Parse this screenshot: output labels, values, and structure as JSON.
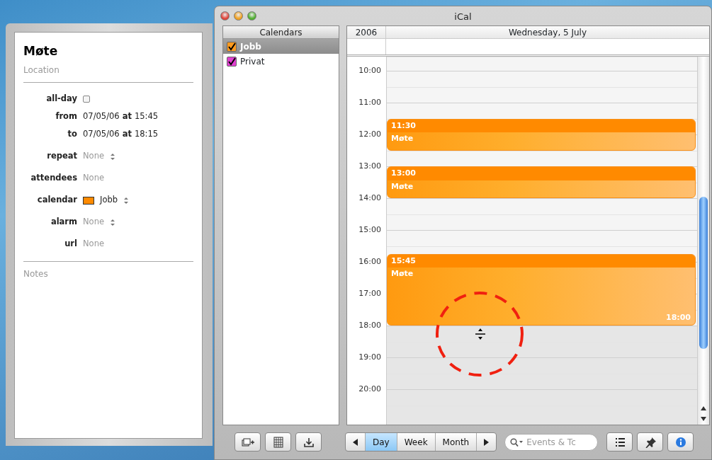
{
  "info_panel": {
    "title": "Møte",
    "location_placeholder": "Location",
    "fields": [
      {
        "kind": "checkbox",
        "label": "all-day",
        "checked": false
      },
      {
        "kind": "date",
        "label": "from",
        "value": "07/05/06 **at** 15:45"
      },
      {
        "kind": "date",
        "label": "to",
        "value": "07/05/06 **at** 18:15"
      },
      {
        "kind": "select",
        "label": "repeat",
        "placeholder": "None"
      },
      {
        "kind": "text",
        "label": "attendees",
        "placeholder": "None"
      },
      {
        "kind": "color-select",
        "label": "calendar",
        "value": "Jobb",
        "color": "#ff8a00"
      },
      {
        "kind": "select",
        "label": "alarm",
        "placeholder": "None"
      },
      {
        "kind": "text",
        "label": "url",
        "placeholder": "None"
      }
    ],
    "notes_placeholder": "Notes"
  },
  "window": {
    "title": "iCal"
  },
  "calendars": {
    "header": "Calendars",
    "items": [
      {
        "label": "Jobb",
        "checked": true,
        "selected": true,
        "color": "#ff9a1f"
      },
      {
        "label": "Privat",
        "checked": true,
        "selected": false,
        "color": "#e040d0"
      }
    ]
  },
  "day_view": {
    "year": "2006",
    "date": "Wednesday, 5 July",
    "hours": [
      "10:00",
      "11:00",
      "12:00",
      "13:00",
      "14:00",
      "15:00",
      "16:00",
      "17:00",
      "18:00",
      "19:00",
      "20:00"
    ],
    "events": [
      {
        "start": "11:30",
        "title": "Møte"
      },
      {
        "start": "13:00",
        "title": "Møte"
      },
      {
        "start": "15:45",
        "title": "Møte",
        "end": "18:00"
      }
    ]
  },
  "toolbar": {
    "views": [
      {
        "label": "Day",
        "selected": true
      },
      {
        "label": "Week",
        "selected": false
      },
      {
        "label": "Month",
        "selected": false
      }
    ],
    "search_placeholder": "Events & Tc"
  }
}
